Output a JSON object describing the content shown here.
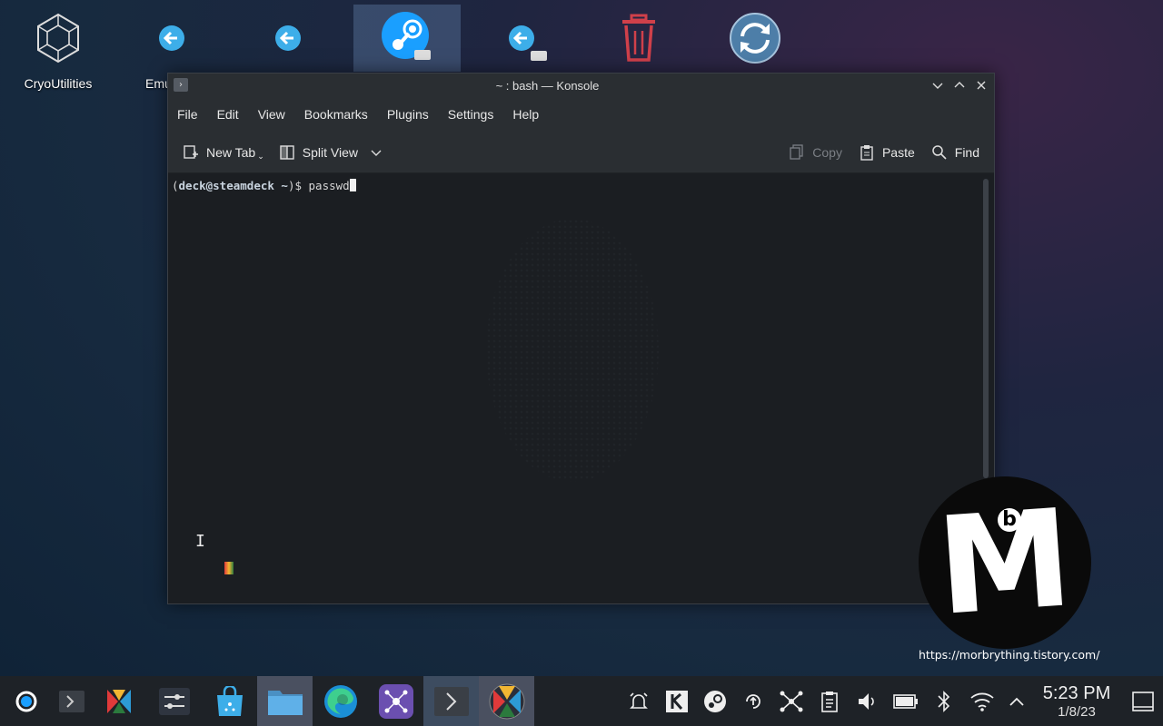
{
  "desktop": {
    "icons": [
      {
        "label": "CryoUtilities",
        "icon": "hexagon-network-icon"
      },
      {
        "label": "Emu",
        "icon": "back-arrow-disc-icon"
      },
      {
        "label": "",
        "icon": "back-arrow-disc-icon"
      },
      {
        "label": "",
        "icon": "steam-icon"
      },
      {
        "label": "",
        "icon": "back-arrow-disc-icon"
      },
      {
        "label": "",
        "icon": "trash-icon"
      },
      {
        "label": "",
        "icon": "refresh-icon"
      }
    ]
  },
  "window": {
    "title": "~ : bash — Konsole",
    "menu": [
      "File",
      "Edit",
      "View",
      "Bookmarks",
      "Plugins",
      "Settings",
      "Help"
    ],
    "toolbar": {
      "new_tab": "New Tab",
      "split_view": "Split View",
      "copy": "Copy",
      "paste": "Paste",
      "find": "Find"
    },
    "terminal": {
      "prompt_open": "(",
      "user_host": "deck@steamdeck",
      "path": " ~",
      "prompt_close": ")$ ",
      "command": "passwd"
    }
  },
  "brand": {
    "letter": "M",
    "small": "b",
    "url": "https://morbrything.tistory.com/"
  },
  "taskbar": {
    "apps": [
      "steam-deck-icon",
      "konsole-icon",
      "heroic-icon",
      "settings-icon",
      "discover-store-icon",
      "file-manager-icon",
      "edge-icon",
      "network-app-icon",
      "terminal-icon",
      "heroic-icon"
    ],
    "tray": [
      "alarm-icon",
      "k-icon",
      "steam-icon",
      "update-icon",
      "network-graph-icon",
      "clipboard-icon",
      "volume-icon",
      "battery-icon",
      "bluetooth-icon",
      "wifi-icon",
      "chevron-up-icon"
    ],
    "time": "5:23 PM",
    "date": "1/8/23"
  },
  "colors": {
    "accent": "#3daee9",
    "trash": "#d0404a"
  }
}
